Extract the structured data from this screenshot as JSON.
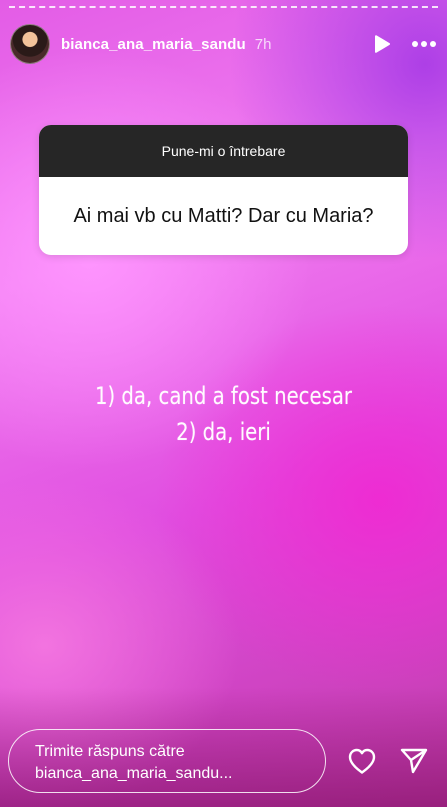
{
  "header": {
    "username": "bianca_ana_maria_sandu",
    "time": "7h",
    "avatar_icon": "profile-avatar",
    "play_icon": "play-icon",
    "more_icon": "more-options-icon"
  },
  "question_sticker": {
    "title": "Pune-mi o întrebare",
    "question": "Ai mai vb cu Matti? Dar cu Maria?"
  },
  "answer": {
    "line1": "1) da, cand a fost necesar",
    "line2": "2) da, ieri"
  },
  "reply": {
    "line1": "Trimite răspuns către",
    "line2": "bianca_ana_maria_sandu..."
  },
  "actions": {
    "like_icon": "heart-icon",
    "send_icon": "send-icon"
  },
  "colors": {
    "sticker_header": "#262626",
    "sticker_body": "#ffffff",
    "text": "#ffffff"
  }
}
